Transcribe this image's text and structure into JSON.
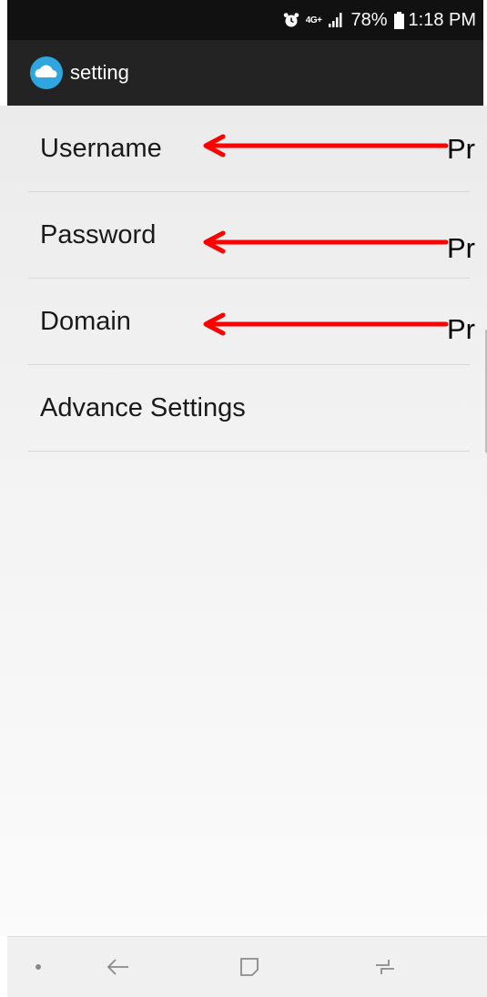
{
  "status_bar": {
    "network": "4G+",
    "battery": "78%",
    "time": "1:18 PM",
    "icons": [
      "alarm-icon",
      "signal-icon",
      "battery-icon"
    ]
  },
  "app_bar": {
    "title": "setting",
    "icon": "cloud-icon",
    "accent_color": "#2fa6df"
  },
  "settings": {
    "items": [
      {
        "label": "Username"
      },
      {
        "label": "Password"
      },
      {
        "label": "Domain"
      },
      {
        "label": "Advance Settings"
      }
    ]
  },
  "annotations": {
    "arrow_color": "#ff0000",
    "labels": [
      "Pr",
      "Pr",
      "Pr"
    ]
  },
  "nav_bar": {
    "icons": [
      "dot-icon",
      "back-icon",
      "home-icon",
      "recents-icon"
    ]
  }
}
